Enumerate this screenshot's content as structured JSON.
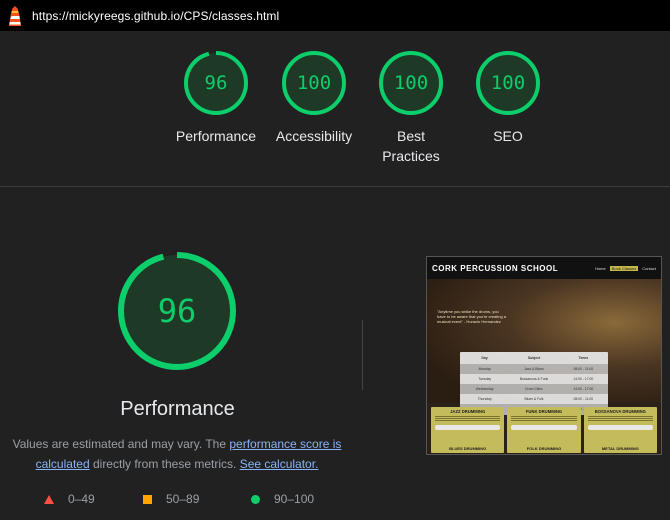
{
  "browser": {
    "url": "https://mickyreegs.github.io/CPS/classes.html"
  },
  "colors": {
    "pass": "#0cce6b",
    "average": "#ffa400",
    "fail": "#ff4e42",
    "link": "#8ab4f8"
  },
  "gauges": [
    {
      "value": "96",
      "label": "Performance",
      "score": 0.96
    },
    {
      "value": "100",
      "label": "Accessibility",
      "score": 1.0
    },
    {
      "value": "100",
      "label": "Best Practices",
      "score": 1.0
    },
    {
      "value": "100",
      "label": "SEO",
      "score": 1.0
    }
  ],
  "performance": {
    "value": "96",
    "score": 0.96,
    "title": "Performance",
    "desc_pre": "Values are estimated and may vary. The ",
    "desc_link1": "performance score is calculated",
    "desc_mid": " directly from these metrics. ",
    "desc_link2": "See calculator."
  },
  "legend": [
    {
      "range": "0–49",
      "icon": "red-triangle-icon"
    },
    {
      "range": "50–89",
      "icon": "orange-square-icon"
    },
    {
      "range": "90–100",
      "icon": "green-circle-icon"
    }
  ],
  "thumbnail": {
    "brand": "CORK PERCUSSION SCHOOL",
    "nav": [
      "Home",
      "Book Classes",
      "Contact"
    ],
    "quote": "\"Anytime you strike the drums, you have to be aware that you're creating a musical event\" - Horacio Hernandez",
    "table_head": [
      "Day",
      "Subject",
      "Times"
    ],
    "table_rows": [
      [
        "Monday",
        "Jazz & Blues",
        "08:00 - 11:00"
      ],
      [
        "Tuesday",
        "Bossanova & Funk",
        "14:00 - 17:00"
      ],
      [
        "Wednesday",
        "Drum Clinic",
        "14:00 - 17:00"
      ],
      [
        "Thursday",
        "Blues & Folk",
        "08:00 - 11:00"
      ],
      [
        "Friday",
        "Metal & Rock",
        "14:00 - 17:00"
      ]
    ],
    "cards": [
      {
        "title": "JAZZ DRUMMING",
        "bottom": "BLUES DRUMMING"
      },
      {
        "title": "FUNK DRUMMING",
        "bottom": "FOLK DRUMMING"
      },
      {
        "title": "BOSSANOVA DRUMMING",
        "bottom": "METAL DRUMMING"
      }
    ]
  }
}
